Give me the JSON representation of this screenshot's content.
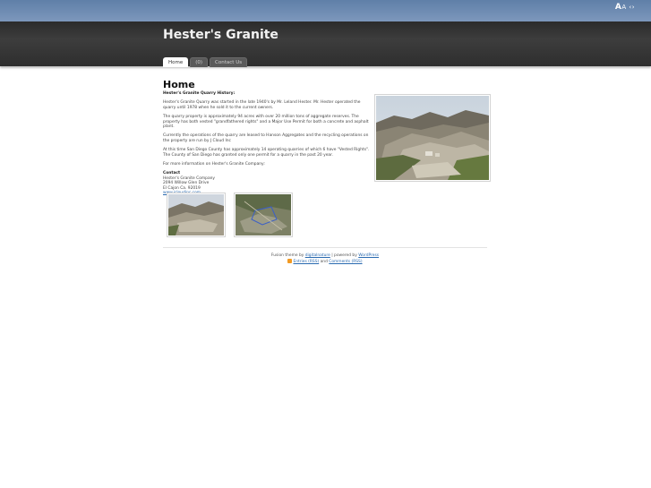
{
  "font_size_widget": {
    "large": "A",
    "small": "A",
    "arrows": "‹›"
  },
  "site": {
    "title": "Hester's Granite"
  },
  "nav": {
    "tabs": [
      {
        "label": "Home",
        "active": true
      },
      {
        "label": "(0)",
        "active": false
      },
      {
        "label": "Contact Us",
        "active": false
      }
    ]
  },
  "page": {
    "title": "Home",
    "heading": "Hester's Granite Quarry History:",
    "paragraphs": [
      "Hester's Granite Quarry was started in the late 1940's by Mr. Leland Hester. Mr. Hester operated the quarry until 1978 when he sold it to the current owners.",
      "The quarry property is approximately 94 acres with over 20 million tons of aggregate reserves. The property has both vested \"grandfathered rights\" and a Major Use Permit for both a concrete and asphalt plant.",
      "Currently the operations of the quarry are leased to Hanson Aggregates and the recycling operations on the property are run by J Cloud Inc",
      "At this time San Diego County has approximately 14 operating quarries of which 6 have \"Vested Rights\". The County of San Diego has granted only one permit for a quarry in the past 20 year.",
      "For more information on Hester's Granite Company:"
    ],
    "contact": {
      "heading": "Contact",
      "company": "Hester's Granite Company",
      "street": "2094 Willow Glen Drive",
      "city": "El Cajon Ca. 92019",
      "link": "www.jcloudinc.com"
    }
  },
  "footer": {
    "line1_prefix": "Fusion theme by",
    "theme_author": "digitalnature",
    "line1_sep": "| powered by",
    "platform": "WordPress",
    "entries": "Entries (RSS)",
    "and": "and",
    "comments": "Comments (RSS)"
  },
  "colors": {
    "topbar": "#6a88b0",
    "header": "#333333",
    "link": "#2a6ab0"
  }
}
